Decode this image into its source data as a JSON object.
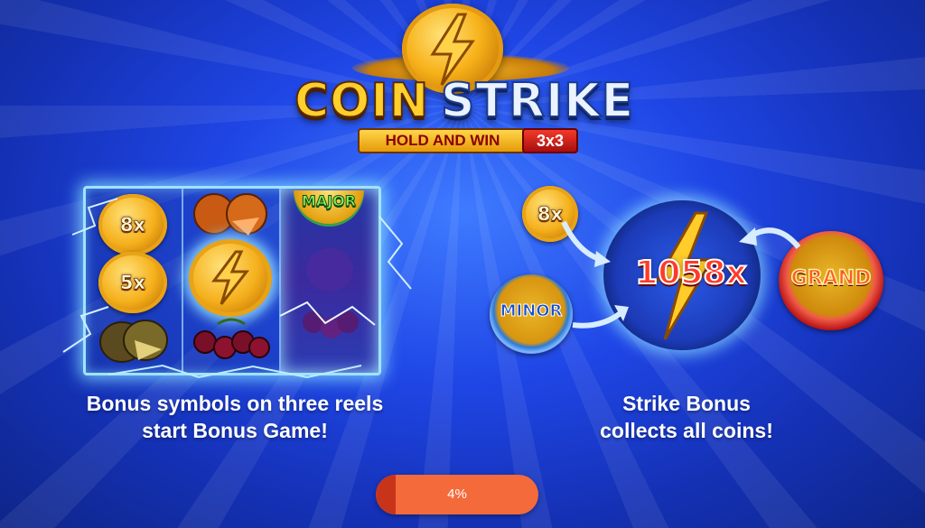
{
  "logo": {
    "title_part1": "COIN",
    "title_part2": "STRIKE",
    "subtitle": "HOLD AND WIN",
    "subtitle_badge": "3x3"
  },
  "left_panel": {
    "reel1": {
      "coins": [
        "8x",
        "5x"
      ]
    },
    "reel2": {
      "fruits": [
        "orange",
        "bonus-strike-coin",
        "cherries"
      ]
    },
    "reel3": {
      "top_coin": "MAJOR"
    },
    "caption_line1": "Bonus symbols on three reels",
    "caption_line2": "start Bonus Game!"
  },
  "right_panel": {
    "small_coin": "8x",
    "minor_coin": "MINOR",
    "center_multiplier": "1058x",
    "grand_coin": "GRAND",
    "caption_line1": "Strike Bonus",
    "caption_line2": "collects all coins!"
  },
  "loading": {
    "progress_fraction": 0.04,
    "label": "4%"
  },
  "colors": {
    "background": "#1f46e6",
    "gold": "#f5b01c",
    "progress_track": "#f56a3a",
    "progress_fill": "#c7341a",
    "lightning": "#9fe3ff"
  }
}
